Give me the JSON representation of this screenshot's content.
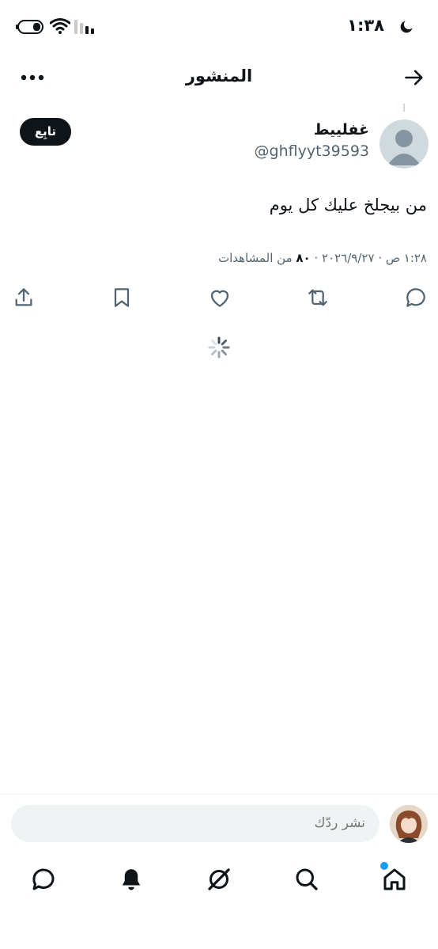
{
  "status_bar": {
    "time": "١:٣٨",
    "icons": [
      "moon-icon",
      "battery-icon",
      "wifi-icon",
      "signal-icon"
    ]
  },
  "header": {
    "title": "المنشور",
    "back_icon": "arrow-right-icon",
    "more_icon": "more-horizontal-icon"
  },
  "post": {
    "author_name": "غفلييط",
    "author_handle": "@ghflyyt39593",
    "follow_label": "تابِع",
    "text": "من بيجلخ عليك كل يوم",
    "date_time": "١:٢٨ ص · ٢٠٢٦/٩/٢٧ · ",
    "views_count": "٨٠",
    "views_label": " من المشاهدات"
  },
  "actions": [
    "reply-icon",
    "repost-icon",
    "like-icon",
    "bookmark-icon",
    "share-icon"
  ],
  "composer": {
    "placeholder": "نشر ردّك"
  },
  "bottom_nav": [
    "home-icon",
    "search-icon",
    "grok-icon",
    "notifications-icon",
    "messages-icon"
  ],
  "colors": {
    "accent": "#1d9bf0",
    "text_primary": "#0f1419",
    "text_secondary": "#536471",
    "input_bg": "#eff3f4"
  }
}
